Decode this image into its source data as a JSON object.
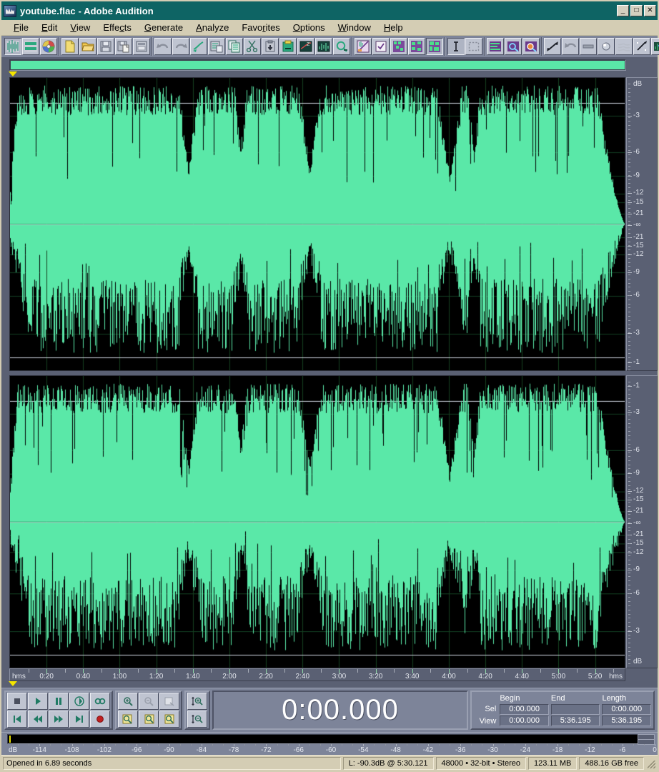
{
  "window": {
    "title": "youtube.flac - Adobe Audition",
    "icon": "audition-app-icon",
    "controls": {
      "minimize": "_",
      "maximize": "□",
      "close": "✕"
    }
  },
  "menu": {
    "items": [
      {
        "label": "File",
        "accel": "F"
      },
      {
        "label": "Edit",
        "accel": "E"
      },
      {
        "label": "View",
        "accel": "V"
      },
      {
        "label": "Effects",
        "accel": "c"
      },
      {
        "label": "Generate",
        "accel": "G"
      },
      {
        "label": "Analyze",
        "accel": "A"
      },
      {
        "label": "Favorites",
        "accel": "r"
      },
      {
        "label": "Options",
        "accel": "O"
      },
      {
        "label": "Window",
        "accel": "W"
      },
      {
        "label": "Help",
        "accel": "H"
      }
    ]
  },
  "toolbar": {
    "groups": [
      {
        "name": "view-mode",
        "buttons": [
          {
            "name": "waveform-view-icon",
            "pressed": true
          },
          {
            "name": "multitrack-view-icon",
            "pressed": false
          },
          {
            "name": "cd-view-icon",
            "pressed": false
          }
        ]
      },
      {
        "name": "file-ops",
        "buttons": [
          {
            "name": "new-file-icon",
            "pressed": false
          },
          {
            "name": "open-file-icon",
            "pressed": false
          },
          {
            "name": "save-file-icon",
            "pressed": false
          },
          {
            "name": "save-as-icon",
            "pressed": false
          },
          {
            "name": "close-file-icon",
            "pressed": false
          }
        ]
      },
      {
        "name": "edit-ops",
        "buttons": [
          {
            "name": "undo-icon",
            "pressed": false
          },
          {
            "name": "redo-icon",
            "pressed": false
          },
          {
            "name": "repair-transient-icon",
            "pressed": false
          },
          {
            "name": "mix-paste-icon",
            "pressed": false
          },
          {
            "name": "copy-icon",
            "pressed": false
          },
          {
            "name": "cut-icon",
            "pressed": false
          },
          {
            "name": "paste-icon",
            "pressed": false
          },
          {
            "name": "paste-to-new-icon",
            "pressed": false
          },
          {
            "name": "trim-icon",
            "pressed": false
          },
          {
            "name": "noise-reduction-icon",
            "pressed": false
          },
          {
            "name": "find-beats-icon",
            "pressed": false
          }
        ]
      },
      {
        "name": "effects-rack",
        "buttons": [
          {
            "name": "amplitude-graph-icon",
            "pressed": false
          },
          {
            "name": "checkbox-tool-icon",
            "pressed": false
          },
          {
            "name": "spectral-1-icon",
            "pressed": false
          },
          {
            "name": "spectral-2-icon",
            "pressed": false
          },
          {
            "name": "spectral-3-icon",
            "pressed": true
          }
        ]
      },
      {
        "name": "select-tools",
        "buttons": [
          {
            "name": "time-selection-icon",
            "pressed": true
          },
          {
            "name": "marquee-selection-icon",
            "pressed": false
          }
        ]
      },
      {
        "name": "display-tools",
        "buttons": [
          {
            "name": "waveform-display-icon",
            "pressed": false
          },
          {
            "name": "spectral-frequency-icon",
            "pressed": false
          },
          {
            "name": "spectral-pan-icon",
            "pressed": false
          }
        ]
      },
      {
        "name": "spectral-edit-tools",
        "buttons": [
          {
            "name": "move-tool-icon",
            "pressed": false
          },
          {
            "name": "lasso-undo-icon",
            "pressed": false
          },
          {
            "name": "rectangle-marquee-icon",
            "pressed": false
          },
          {
            "name": "spot-healing-brush-icon",
            "pressed": false
          },
          {
            "name": "paintbrush-icon",
            "pressed": false
          },
          {
            "name": "magic-wand-icon",
            "pressed": false
          },
          {
            "name": "heal-selection-icon",
            "pressed": false
          }
        ]
      }
    ]
  },
  "editor": {
    "overview_name": "horizontal-range-overview",
    "cue_marker_name": "start-cue-marker",
    "channels": [
      {
        "name": "left-channel",
        "db_header": "dB"
      },
      {
        "name": "right-channel",
        "db_header": "dB"
      }
    ],
    "db_scale_top": [
      "-3",
      "-6",
      "-9",
      "-12",
      "-15",
      "-21",
      "-∞",
      "-21",
      "-15",
      "-12",
      "-9",
      "-6",
      "-3",
      "-1"
    ],
    "db_scale_bottom": [
      "-1",
      "-3",
      "-6",
      "-9",
      "-12",
      "-15",
      "-21",
      "-∞",
      "-21",
      "-15",
      "-12",
      "-9",
      "-6",
      "-3"
    ],
    "db_header": "dB",
    "time_ruler": {
      "unit_left": "hms",
      "unit_right": "hms",
      "labels": [
        "0:20",
        "0:40",
        "1:00",
        "1:20",
        "1:40",
        "2:00",
        "2:20",
        "2:40",
        "3:00",
        "3:20",
        "3:40",
        "4:00",
        "4:20",
        "4:40",
        "5:00",
        "5:20"
      ],
      "total_seconds": 336.195
    },
    "waveform_color": "#5ae8a8",
    "background_color": "#000000"
  },
  "transport": {
    "playback_buttons_row1": [
      {
        "name": "stop-button",
        "glyph": "stop"
      },
      {
        "name": "play-button",
        "glyph": "play"
      },
      {
        "name": "pause-button",
        "glyph": "pause"
      },
      {
        "name": "play-from-cursor-button",
        "glyph": "play-circle"
      },
      {
        "name": "play-looped-button",
        "glyph": "loop"
      }
    ],
    "playback_buttons_row2": [
      {
        "name": "go-to-beginning-button",
        "glyph": "skip-back"
      },
      {
        "name": "rewind-button",
        "glyph": "rewind"
      },
      {
        "name": "fast-forward-button",
        "glyph": "fast-forward"
      },
      {
        "name": "go-to-end-button",
        "glyph": "skip-forward"
      },
      {
        "name": "record-button",
        "glyph": "record"
      }
    ],
    "zoom_buttons_row1": [
      {
        "name": "zoom-in-horizontally-button",
        "glyph": "zoom-in"
      },
      {
        "name": "zoom-out-horizontally-button",
        "glyph": "zoom-out"
      },
      {
        "name": "zoom-out-full-both-axes-button",
        "glyph": "zoom-full"
      }
    ],
    "zoom_buttons_row2": [
      {
        "name": "zoom-to-selection-left-button",
        "glyph": "zoom-sel-left"
      },
      {
        "name": "zoom-to-selection-right-button",
        "glyph": "zoom-sel-right"
      },
      {
        "name": "zoom-to-selection-button",
        "glyph": "zoom-sel"
      }
    ],
    "vzoom_buttons": [
      {
        "name": "zoom-in-vertically-button",
        "glyph": "vzoom-in"
      },
      {
        "name": "zoom-out-vertically-button",
        "glyph": "vzoom-out"
      }
    ],
    "time_display": "0:00.000",
    "time_display_name": "current-time-display"
  },
  "selview": {
    "headers": {
      "begin": "Begin",
      "end": "End",
      "length": "Length"
    },
    "rows": [
      {
        "label": "Sel",
        "begin": "0:00.000",
        "end": "",
        "length": "0:00.000"
      },
      {
        "label": "View",
        "begin": "0:00.000",
        "end": "5:36.195",
        "length": "5:36.195"
      }
    ]
  },
  "level_meter": {
    "unit": "dB",
    "labels": [
      "-114",
      "-108",
      "-102",
      "-96",
      "-90",
      "-84",
      "-78",
      "-72",
      "-66",
      "-60",
      "-54",
      "-48",
      "-42",
      "-36",
      "-30",
      "-24",
      "-18",
      "-12",
      "-6",
      "0"
    ],
    "range_min": -120,
    "range_max": 0
  },
  "status": {
    "message": "Opened in 6.89 seconds",
    "cells": [
      {
        "name": "cursor-level-readout",
        "text": "L: -90.3dB @   5:30.121"
      },
      {
        "name": "file-format-readout",
        "text": "48000 • 32-bit • Stereo"
      },
      {
        "name": "file-size-readout",
        "text": "123.11 MB"
      },
      {
        "name": "free-space-readout",
        "text": "488.16 GB free"
      }
    ]
  },
  "colors": {
    "title_bar": "#0e6464",
    "menu_bar": "#d4cdb4",
    "toolbar": "#7d8499",
    "panel": "#5a6073",
    "waveform": "#5ae8a8",
    "wave_background": "#000000",
    "cue_marker": "#f4e500"
  }
}
